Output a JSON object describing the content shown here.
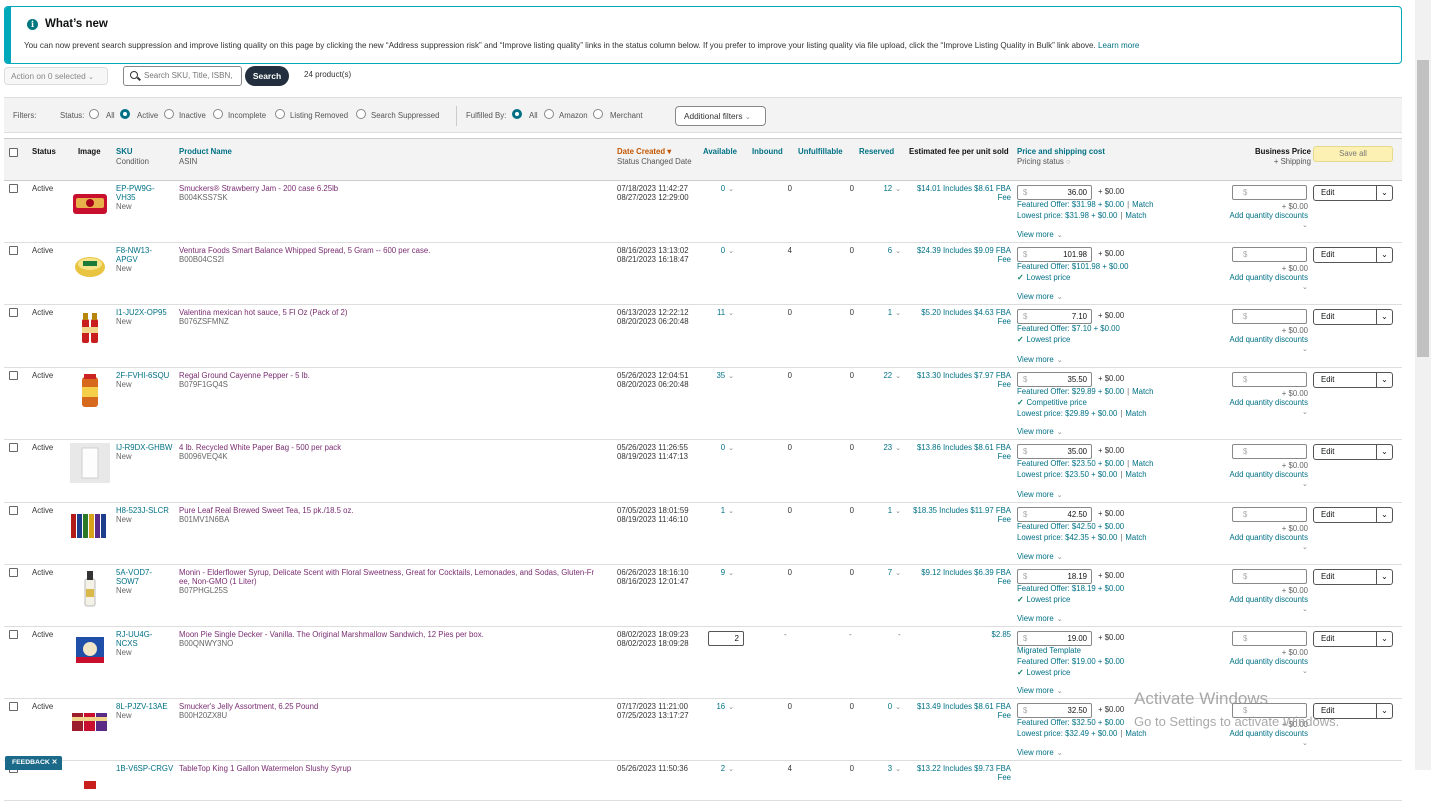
{
  "banner": {
    "title": "What’s new",
    "message": "You can now prevent search suppression and improve listing quality on this page by clicking the new “Address suppression risk” and “Improve listing quality” links in the status column below. If you prefer to improve your listing quality via file upload, click the “Improve Listing Quality in Bulk” link above.",
    "learn_more": "Learn more"
  },
  "toolbar": {
    "action_label": "Action on 0 selected",
    "search_placeholder": "Search SKU, Title, ISBN,",
    "search_button": "Search",
    "product_count": "24 product(s)"
  },
  "filters": {
    "label": "Filters:",
    "status_label": "Status:",
    "status_options": [
      "All",
      "Active",
      "Inactive",
      "Incomplete",
      "Listing Removed",
      "Search Suppressed"
    ],
    "status_selected": "Active",
    "fulfilled_label": "Fulfilled By:",
    "fulfilled_options": [
      "All",
      "Amazon",
      "Merchant"
    ],
    "fulfilled_selected": "All",
    "additional": "Additional filters"
  },
  "columns": {
    "status": "Status",
    "image": "Image",
    "sku": "SKU",
    "condition": "Condition",
    "product_name": "Product Name",
    "asin": "ASIN",
    "date_created": "Date Created",
    "status_changed": "Status Changed Date",
    "available": "Available",
    "inbound": "Inbound",
    "unfulfillable": "Unfulfillable",
    "reserved": "Reserved",
    "est_fee": "Estimated fee per unit sold",
    "price_ship": "Price and shipping cost",
    "pricing_status": "Pricing status",
    "business_price": "Business Price",
    "plus_shipping": "+ Shipping",
    "save_all": "Save all"
  },
  "common": {
    "view_more": "View more",
    "add_qty": "Add quantity discounts",
    "plus_zero": "+ $0.00",
    "edit": "Edit",
    "dollar": "$",
    "fee_word": "Fee"
  },
  "rows": [
    {
      "status": "Active",
      "sku": "EP-PW9G-",
      "sku2": "VH35",
      "cond": "New",
      "name": "Smuckers® Strawberry Jam - 200 case 6.25lb",
      "name2": "",
      "asin": "B004KSS7SK",
      "created": "07/18/2023 11:42:27",
      "changed": "08/27/2023 12:29:00",
      "avail": "0",
      "inbound": "0",
      "unful": "0",
      "reserved": "12",
      "fee": "$14.01 Includes $8.61 FBA",
      "price": "36.00",
      "ship": "+ $0.00",
      "line1": "Featured Offer: $31.98 + $0.00",
      "line1b": "Match",
      "line2": "Lowest price: $31.98 + $0.00",
      "line2b": "Match",
      "line2check": false
    },
    {
      "status": "Active",
      "sku": "F8-NW13-",
      "sku2": "APGV",
      "cond": "New",
      "name": "Ventura Foods Smart Balance Whipped Spread, 5 Gram -- 600 per case.",
      "name2": "",
      "asin": "B00B04CS2I",
      "created": "08/16/2023 13:13:02",
      "changed": "08/21/2023 16:18:47",
      "avail": "0",
      "inbound": "4",
      "unful": "0",
      "reserved": "6",
      "fee": "$24.39 Includes $9.09 FBA",
      "price": "101.98",
      "ship": "+ $0.00",
      "line1": "Featured Offer: $101.98 + $0.00",
      "line1b": "",
      "line2": "Lowest price",
      "line2b": "",
      "line2check": true
    },
    {
      "status": "Active",
      "sku": "I1-JU2X-OP95",
      "sku2": "",
      "cond": "New",
      "name": "Valentina mexican hot sauce, 5 Fl Oz (Pack of 2)",
      "name2": "",
      "asin": "B076ZSFMNZ",
      "created": "06/13/2023 12:22:12",
      "changed": "08/20/2023 06:20:48",
      "avail": "11",
      "inbound": "0",
      "unful": "0",
      "reserved": "1",
      "fee": "$5.20 Includes $4.63 FBA",
      "price": "7.10",
      "ship": "+ $0.00",
      "line1": "Featured Offer: $7.10 + $0.00",
      "line1b": "",
      "line2": "Lowest price",
      "line2b": "",
      "line2check": true
    },
    {
      "status": "Active",
      "sku": "2F-FVHI-6SQU",
      "sku2": "",
      "cond": "New",
      "name": "Regal Ground Cayenne Pepper - 5 lb.",
      "name2": "",
      "asin": "B079F1GQ4S",
      "created": "05/26/2023 12:04:51",
      "changed": "08/20/2023 06:20:48",
      "avail": "35",
      "inbound": "0",
      "unful": "0",
      "reserved": "22",
      "fee": "$13.30 Includes $7.97 FBA",
      "price": "35.50",
      "ship": "+ $0.00",
      "line1": "Featured Offer: $29.89 + $0.00",
      "line1b": "Match",
      "line2": "Competitive price",
      "line2b": "",
      "line2check": true,
      "line3": "Lowest price: $29.89 + $0.00",
      "line3b": "Match"
    },
    {
      "status": "Active",
      "sku": "IJ-R9DX-GHBW",
      "sku2": "",
      "cond": "New",
      "name": "4 lb. Recycled White Paper Bag - 500 per pack",
      "name2": "",
      "asin": "B0096VEQ4K",
      "created": "05/26/2023 11:26:55",
      "changed": "08/19/2023 11:47:13",
      "avail": "0",
      "inbound": "0",
      "unful": "0",
      "reserved": "23",
      "fee": "$13.86 Includes $8.61 FBA",
      "price": "35.00",
      "ship": "+ $0.00",
      "line1": "Featured Offer: $23.50 + $0.00",
      "line1b": "Match",
      "line2": "Lowest price: $23.50 + $0.00",
      "line2b": "Match",
      "line2check": false
    },
    {
      "status": "Active",
      "sku": "H8-523J-SLCR",
      "sku2": "",
      "cond": "New",
      "name": "Pure Leaf Real Brewed Sweet Tea, 15 pk./18.5 oz.",
      "name2": "",
      "asin": "B01MV1N6BA",
      "created": "07/05/2023 18:01:59",
      "changed": "08/19/2023 11:46:10",
      "avail": "1",
      "inbound": "0",
      "unful": "0",
      "reserved": "1",
      "fee": "$18.35 Includes $11.97 FBA",
      "price": "42.50",
      "ship": "+ $0.00",
      "line1": "Featured Offer: $42.50 + $0.00",
      "line1b": "",
      "line2": "Lowest price: $42.35 + $0.00",
      "line2b": "Match",
      "line2check": false
    },
    {
      "status": "Active",
      "sku": "5A-VOD7-",
      "sku2": "SOW7",
      "cond": "New",
      "name": "Monin - Elderflower Syrup, Delicate Scent with Floral Sweetness, Great for Cocktails, Lemonades, and Sodas, Gluten-Fr",
      "name2": "ee, Non-GMO (1 Liter)",
      "asin": "B07PHGL25S",
      "created": "06/26/2023 18:16:10",
      "changed": "08/16/2023 12:01:47",
      "avail": "9",
      "inbound": "0",
      "unful": "0",
      "reserved": "7",
      "fee": "$9.12 Includes $6.39 FBA",
      "price": "18.19",
      "ship": "+ $0.00",
      "line1": "Featured Offer: $18.19 + $0.00",
      "line1b": "",
      "line2": "Lowest price",
      "line2b": "",
      "line2check": true
    },
    {
      "status": "Active",
      "sku": "RJ-UU4G-",
      "sku2": "NCXS",
      "cond": "New",
      "name": "Moon Pie Single Decker - Vanilla. The Original Marshmallow Sandwich, 12 Pies per box.",
      "name2": "",
      "asin": "B00QNWY3NO",
      "created": "08/02/2023 18:09:23",
      "changed": "08/02/2023 18:09:28",
      "avail": "2",
      "inbound": "-",
      "unful": "-",
      "reserved": "-",
      "fee": "$2.85",
      "price": "19.00",
      "ship": "+ $0.00",
      "line0": "Migrated Template",
      "line1": "Featured Offer: $19.00 + $0.00",
      "line1b": "",
      "line2": "Lowest price",
      "line2b": "",
      "line2check": true
    },
    {
      "status": "Active",
      "sku": "8L-PJZV-13AE",
      "sku2": "",
      "cond": "New",
      "name": "Smucker's Jelly Assortment, 6.25 Pound",
      "name2": "",
      "asin": "B00H20ZX8U",
      "created": "07/17/2023 11:21:00",
      "changed": "07/25/2023 13:17:27",
      "avail": "16",
      "inbound": "0",
      "unful": "0",
      "reserved": "0",
      "fee": "$13.49 Includes $8.61 FBA",
      "price": "32.50",
      "ship": "+ $0.00",
      "line1": "Featured Offer: $32.50 + $0.00",
      "line1b": "",
      "line2": "Lowest price: $32.49 + $0.00",
      "line2b": "Match",
      "line2check": false
    },
    {
      "status": "",
      "sku": "1B-V6SP-CRGV",
      "sku2": "",
      "cond": "",
      "name": "TableTop King 1 Gallon Watermelon Slushy Syrup",
      "name2": "",
      "asin": "",
      "created": "05/26/2023 11:50:36",
      "changed": "",
      "avail": "2",
      "inbound": "4",
      "unful": "0",
      "reserved": "3",
      "fee": "$13.22 Includes $9.73 FBA",
      "price": "",
      "ship": "",
      "line1": "",
      "line1b": "",
      "line2": "",
      "line2b": "",
      "line2check": false
    }
  ],
  "windows": {
    "line1": "Activate Windows",
    "line2": "Go to Settings to activate Windows."
  },
  "feedback": "FEEDBACK"
}
